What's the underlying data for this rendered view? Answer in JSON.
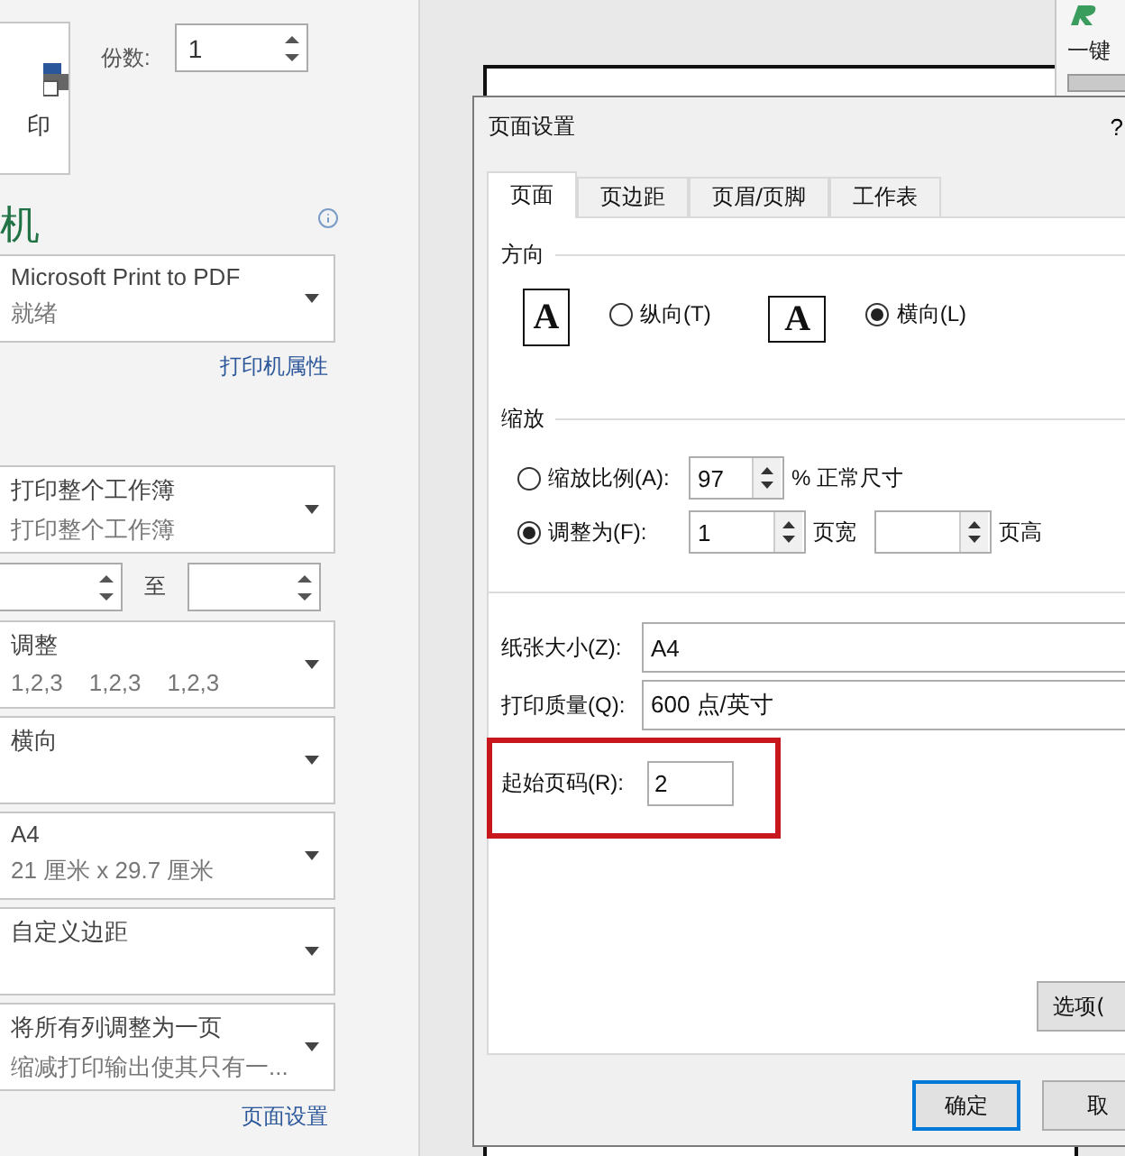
{
  "backstage": {
    "print_button": {
      "label": "印"
    },
    "copies": {
      "label": "份数:",
      "value": "1"
    },
    "printer_heading": "机",
    "printer": {
      "name": "Microsoft Print to PDF",
      "status": "就绪"
    },
    "printer_properties_link": "打印机属性",
    "what_to_print": {
      "title": "打印整个工作簿",
      "subtitle": "打印整个工作簿"
    },
    "pages": {
      "to_label": "至"
    },
    "settings": [
      {
        "title": "调整",
        "subtitle": "1,2,3    1,2,3    1,2,3"
      },
      {
        "title": "横向"
      },
      {
        "title": "A4",
        "subtitle": "21 厘米 x 29.7 厘米"
      },
      {
        "title": "自定义边距"
      },
      {
        "title": "将所有列调整为一页",
        "subtitle": "缩减打印输出使其只有一..."
      }
    ],
    "page_setup_link": "页面设置"
  },
  "side_window": {
    "title": "一键"
  },
  "dialog": {
    "title": "页面设置",
    "help": "?",
    "tabs": [
      {
        "label": "页面",
        "selected": true
      },
      {
        "label": "页边距",
        "selected": false
      },
      {
        "label": "页眉/页脚",
        "selected": false
      },
      {
        "label": "工作表",
        "selected": false
      }
    ],
    "orientation": {
      "heading": "方向",
      "options": [
        {
          "kind": "portrait",
          "glyph": "A",
          "label": "纵向(T)",
          "selected": false
        },
        {
          "kind": "landscape",
          "glyph": "A",
          "label": "横向(L)",
          "selected": true
        }
      ]
    },
    "scaling": {
      "heading": "缩放",
      "options": [
        {
          "kind": "percent",
          "label": "缩放比例(A):",
          "selected": false,
          "value": "97",
          "suffix": "% 正常尺寸"
        },
        {
          "kind": "fit",
          "label": "调整为(F):",
          "selected": true,
          "value": "1",
          "wide_label": "页宽",
          "tall_label": "页高"
        }
      ]
    },
    "paper_size": {
      "label": "纸张大小(Z):",
      "value": "A4"
    },
    "print_quality": {
      "label": "打印质量(Q):",
      "value": "600 点/英寸"
    },
    "first_page_number": {
      "label": "起始页码(R):",
      "value": "2",
      "highlighted": true
    },
    "options_button": "选项(",
    "ok_button": "确定",
    "cancel_button": "取"
  }
}
